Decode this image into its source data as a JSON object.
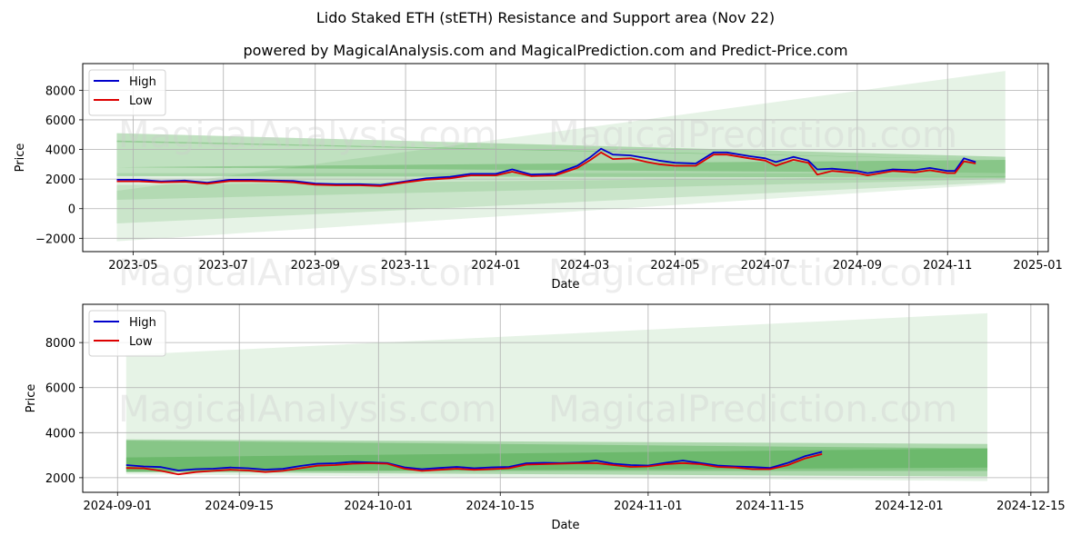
{
  "title": "Lido Staked ETH (stETH) Resistance and Support area (Nov 22)",
  "subtitle": "powered by MagicalAnalysis.com and MagicalPrediction.com and Predict-Price.com",
  "watermarks": [
    "MagicalAnalysis.com",
    "MagicalPrediction.com"
  ],
  "colors": {
    "high": "#0000cc",
    "low": "#dd0000",
    "band": "#2e9a2e"
  },
  "chart_data": [
    {
      "type": "line",
      "name": "full-history",
      "xlabel": "Date",
      "ylabel": "Price",
      "ylim": [
        -2900,
        9800
      ],
      "xlim": [
        "2023-03-28",
        "2025-01-08"
      ],
      "yticks": [
        -2000,
        0,
        2000,
        4000,
        6000,
        8000
      ],
      "ytick_labels": [
        "−2000",
        "0",
        "2000",
        "4000",
        "6000",
        "8000"
      ],
      "xticks": [
        "2023-05-01",
        "2023-07-01",
        "2023-09-01",
        "2023-11-01",
        "2024-01-01",
        "2024-03-01",
        "2024-05-01",
        "2024-07-01",
        "2024-09-01",
        "2024-11-01",
        "2025-01-01"
      ],
      "xtick_labels": [
        "2023-05",
        "2023-07",
        "2023-09",
        "2023-11",
        "2024-01",
        "2024-03",
        "2024-05",
        "2024-07",
        "2024-09",
        "2024-11",
        "2025-01"
      ],
      "grid": true,
      "legend": {
        "position": "top-left",
        "entries": [
          "High",
          "Low"
        ]
      },
      "bands": [
        {
          "x": [
            "2023-04-20",
            "2024-12-10"
          ],
          "upper": [
            5100,
            3500
          ],
          "lower": [
            4500,
            3300
          ],
          "opacity": 0.3
        },
        {
          "x": [
            "2023-04-20",
            "2024-12-10"
          ],
          "upper": [
            4600,
            3300
          ],
          "lower": [
            2800,
            2400
          ],
          "opacity": 0.3
        },
        {
          "x": [
            "2023-04-20",
            "2024-12-10"
          ],
          "upper": [
            2800,
            3300
          ],
          "lower": [
            2200,
            2100
          ],
          "opacity": 0.3
        },
        {
          "x": [
            "2023-04-20",
            "2024-12-10"
          ],
          "upper": [
            2400,
            2400
          ],
          "lower": [
            600,
            2000
          ],
          "opacity": 0.15
        },
        {
          "x": [
            "2023-04-20",
            "2024-12-10"
          ],
          "upper": [
            1600,
            2200
          ],
          "lower": [
            -1000,
            1800
          ],
          "opacity": 0.15
        },
        {
          "x": [
            "2023-04-20",
            "2024-12-10"
          ],
          "upper": [
            1200,
            9300
          ],
          "lower": [
            -2200,
            1700
          ],
          "opacity": 0.12
        }
      ],
      "series": [
        {
          "name": "High",
          "x": [
            "2023-04-20",
            "2023-05-05",
            "2023-05-20",
            "2023-06-05",
            "2023-06-20",
            "2023-07-05",
            "2023-07-20",
            "2023-08-05",
            "2023-08-17",
            "2023-09-01",
            "2023-09-15",
            "2023-10-01",
            "2023-10-15",
            "2023-11-01",
            "2023-11-15",
            "2023-12-01",
            "2023-12-15",
            "2024-01-01",
            "2024-01-12",
            "2024-01-25",
            "2024-02-10",
            "2024-02-25",
            "2024-03-05",
            "2024-03-12",
            "2024-03-20",
            "2024-04-01",
            "2024-04-12",
            "2024-04-20",
            "2024-05-01",
            "2024-05-15",
            "2024-05-27",
            "2024-06-05",
            "2024-06-20",
            "2024-07-01",
            "2024-07-08",
            "2024-07-20",
            "2024-07-30",
            "2024-08-05",
            "2024-08-15",
            "2024-09-01",
            "2024-09-08",
            "2024-09-25",
            "2024-10-10",
            "2024-10-20",
            "2024-11-01",
            "2024-11-06",
            "2024-11-12",
            "2024-11-20"
          ],
          "values": [
            1950,
            1950,
            1850,
            1900,
            1750,
            1950,
            1950,
            1900,
            1880,
            1700,
            1650,
            1650,
            1600,
            1850,
            2050,
            2150,
            2350,
            2350,
            2650,
            2300,
            2350,
            2900,
            3500,
            4050,
            3650,
            3600,
            3400,
            3250,
            3100,
            3050,
            3800,
            3800,
            3550,
            3400,
            3150,
            3500,
            3250,
            2650,
            2700,
            2550,
            2400,
            2650,
            2600,
            2750,
            2550,
            2550,
            3400,
            3150
          ]
        },
        {
          "name": "Low",
          "x": [
            "2023-04-20",
            "2023-05-05",
            "2023-05-20",
            "2023-06-05",
            "2023-06-20",
            "2023-07-05",
            "2023-07-20",
            "2023-08-05",
            "2023-08-17",
            "2023-09-01",
            "2023-09-15",
            "2023-10-01",
            "2023-10-15",
            "2023-11-01",
            "2023-11-15",
            "2023-12-01",
            "2023-12-15",
            "2024-01-01",
            "2024-01-12",
            "2024-01-25",
            "2024-02-10",
            "2024-02-25",
            "2024-03-05",
            "2024-03-12",
            "2024-03-20",
            "2024-04-01",
            "2024-04-12",
            "2024-04-20",
            "2024-05-01",
            "2024-05-15",
            "2024-05-27",
            "2024-06-05",
            "2024-06-20",
            "2024-07-01",
            "2024-07-08",
            "2024-07-20",
            "2024-07-30",
            "2024-08-05",
            "2024-08-15",
            "2024-09-01",
            "2024-09-08",
            "2024-09-25",
            "2024-10-10",
            "2024-10-20",
            "2024-11-01",
            "2024-11-06",
            "2024-11-12",
            "2024-11-20"
          ],
          "values": [
            1850,
            1850,
            1780,
            1820,
            1680,
            1870,
            1870,
            1830,
            1780,
            1620,
            1580,
            1580,
            1530,
            1780,
            1950,
            2050,
            2250,
            2250,
            2500,
            2200,
            2250,
            2750,
            3300,
            3800,
            3350,
            3400,
            3150,
            3000,
            2900,
            2900,
            3650,
            3650,
            3400,
            3250,
            2900,
            3300,
            3100,
            2300,
            2550,
            2400,
            2250,
            2550,
            2450,
            2600,
            2400,
            2400,
            3200,
            3050
          ]
        }
      ]
    },
    {
      "type": "line",
      "name": "recent-zoom",
      "xlabel": "Date",
      "ylabel": "Price",
      "ylim": [
        1350,
        9700
      ],
      "xlim": [
        "2024-08-28",
        "2024-12-17"
      ],
      "yticks": [
        2000,
        4000,
        6000,
        8000
      ],
      "ytick_labels": [
        "2000",
        "4000",
        "6000",
        "8000"
      ],
      "xticks": [
        "2024-09-01",
        "2024-09-15",
        "2024-10-01",
        "2024-10-15",
        "2024-11-01",
        "2024-11-15",
        "2024-12-01",
        "2024-12-15"
      ],
      "xtick_labels": [
        "2024-09-01",
        "2024-09-15",
        "2024-10-01",
        "2024-10-15",
        "2024-11-01",
        "2024-11-15",
        "2024-12-01",
        "2024-12-15"
      ],
      "grid": true,
      "legend": {
        "position": "top-left",
        "entries": [
          "High",
          "Low"
        ]
      },
      "bands": [
        {
          "x": [
            "2024-09-02",
            "2024-12-10"
          ],
          "upper": [
            7450,
            9300
          ],
          "lower": [
            2150,
            1850
          ],
          "opacity": 0.12
        },
        {
          "x": [
            "2024-09-02",
            "2024-12-10"
          ],
          "upper": [
            3700,
            3500
          ],
          "lower": [
            2250,
            2050
          ],
          "opacity": 0.3
        },
        {
          "x": [
            "2024-09-02",
            "2024-12-10"
          ],
          "upper": [
            3650,
            3300
          ],
          "lower": [
            2300,
            2300
          ],
          "opacity": 0.3
        },
        {
          "x": [
            "2024-09-02",
            "2024-12-10"
          ],
          "upper": [
            2900,
            3300
          ],
          "lower": [
            2250,
            2450
          ],
          "opacity": 0.3
        }
      ],
      "series": [
        {
          "name": "High",
          "x": [
            "2024-09-02",
            "2024-09-04",
            "2024-09-06",
            "2024-09-08",
            "2024-09-10",
            "2024-09-12",
            "2024-09-14",
            "2024-09-16",
            "2024-09-18",
            "2024-09-20",
            "2024-09-22",
            "2024-09-24",
            "2024-09-26",
            "2024-09-28",
            "2024-09-30",
            "2024-10-02",
            "2024-10-04",
            "2024-10-06",
            "2024-10-08",
            "2024-10-10",
            "2024-10-12",
            "2024-10-14",
            "2024-10-16",
            "2024-10-18",
            "2024-10-20",
            "2024-10-22",
            "2024-10-24",
            "2024-10-26",
            "2024-10-28",
            "2024-10-30",
            "2024-11-01",
            "2024-11-03",
            "2024-11-05",
            "2024-11-07",
            "2024-11-09",
            "2024-11-11",
            "2024-11-13",
            "2024-11-15",
            "2024-11-17",
            "2024-11-19",
            "2024-11-21"
          ],
          "values": [
            2560,
            2500,
            2470,
            2320,
            2380,
            2400,
            2450,
            2420,
            2360,
            2390,
            2520,
            2620,
            2640,
            2700,
            2680,
            2650,
            2460,
            2380,
            2430,
            2480,
            2420,
            2460,
            2480,
            2640,
            2660,
            2650,
            2680,
            2760,
            2620,
            2560,
            2540,
            2660,
            2760,
            2650,
            2540,
            2500,
            2470,
            2430,
            2650,
            2950,
            3150,
            3420,
            3300,
            3160,
            3230,
            3220,
            3180
          ]
        },
        {
          "name": "Low",
          "x": [
            "2024-09-02",
            "2024-09-04",
            "2024-09-06",
            "2024-09-08",
            "2024-09-10",
            "2024-09-12",
            "2024-09-14",
            "2024-09-16",
            "2024-09-18",
            "2024-09-20",
            "2024-09-22",
            "2024-09-24",
            "2024-09-26",
            "2024-09-28",
            "2024-09-30",
            "2024-10-02",
            "2024-10-04",
            "2024-10-06",
            "2024-10-08",
            "2024-10-10",
            "2024-10-12",
            "2024-10-14",
            "2024-10-16",
            "2024-10-18",
            "2024-10-20",
            "2024-10-22",
            "2024-10-24",
            "2024-10-26",
            "2024-10-28",
            "2024-10-30",
            "2024-11-01",
            "2024-11-03",
            "2024-11-05",
            "2024-11-07",
            "2024-11-09",
            "2024-11-11",
            "2024-11-13",
            "2024-11-15",
            "2024-11-17",
            "2024-11-19",
            "2024-11-21"
          ],
          "values": [
            2430,
            2420,
            2300,
            2150,
            2250,
            2300,
            2350,
            2320,
            2250,
            2300,
            2420,
            2530,
            2560,
            2620,
            2640,
            2620,
            2400,
            2300,
            2350,
            2400,
            2350,
            2380,
            2420,
            2580,
            2600,
            2620,
            2640,
            2650,
            2560,
            2480,
            2500,
            2600,
            2650,
            2600,
            2480,
            2450,
            2380,
            2380,
            2550,
            2850,
            3050,
            3200,
            3080,
            3030,
            3080,
            3100,
            3050
          ]
        }
      ]
    }
  ]
}
